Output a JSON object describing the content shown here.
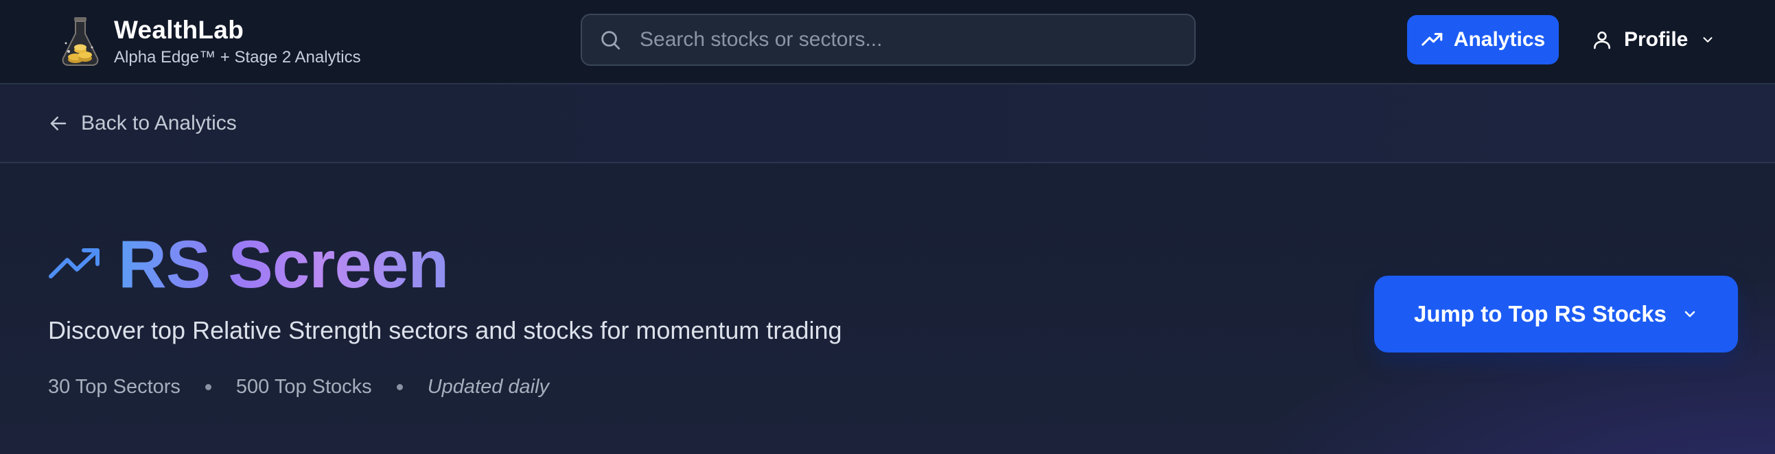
{
  "header": {
    "brand_name": "WealthLab",
    "brand_subtitle": "Alpha Edge™ + Stage 2 Analytics",
    "logo_icon": "flask-with-coins-icon",
    "search_placeholder": "Search stocks or sectors...",
    "analytics_label": "Analytics",
    "profile_label": "Profile"
  },
  "subnav": {
    "back_label": "Back to Analytics"
  },
  "hero": {
    "title": "RS Screen",
    "subtitle": "Discover top Relative Strength sectors and stocks for momentum trading",
    "meta": {
      "sectors": "30 Top Sectors",
      "stocks": "500 Top Stocks",
      "updated": "Updated daily"
    },
    "jump_button_label": "Jump to Top RS Stocks"
  },
  "colors": {
    "accent_blue": "#1c5cf5",
    "topbar_bg": "#111828",
    "title_gradient_start": "#5c9cf5",
    "title_gradient_end": "#b98af2"
  }
}
